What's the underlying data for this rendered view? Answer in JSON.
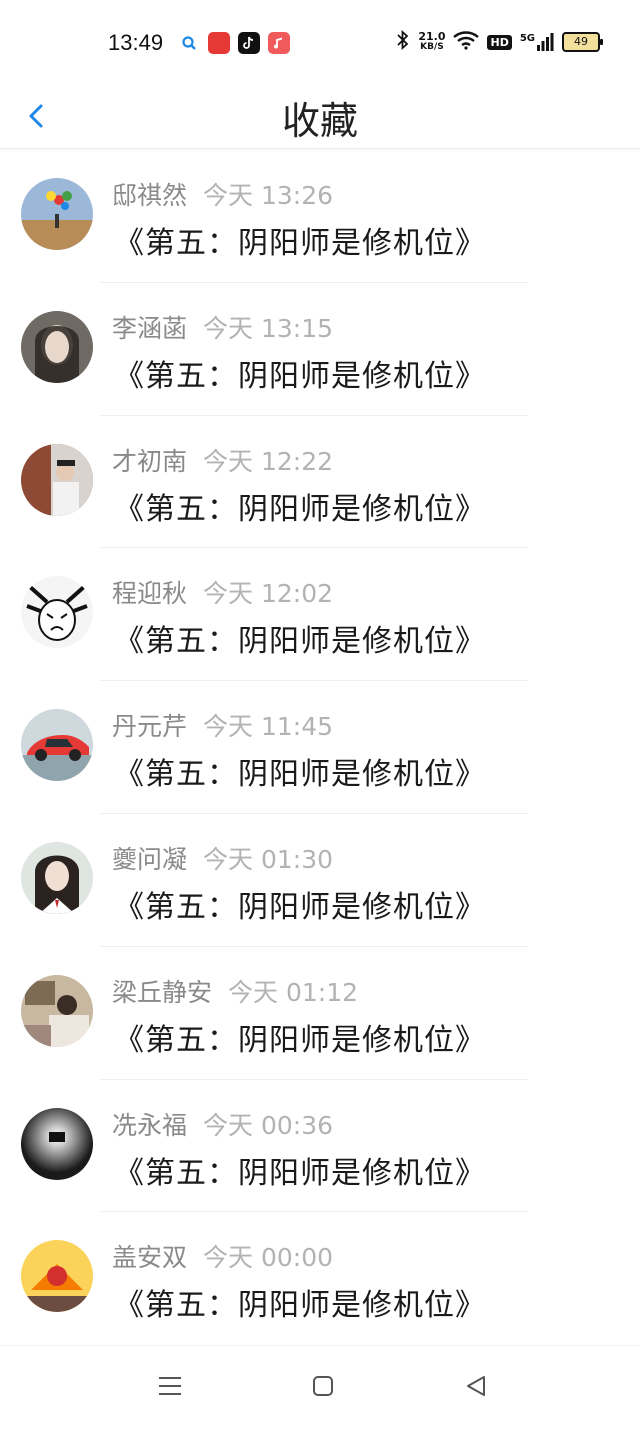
{
  "status_bar": {
    "time": "13:49",
    "network_speed_value": "21.0",
    "network_speed_unit": "KB/S",
    "hd": "HD",
    "signal": "5G",
    "battery": "49",
    "app_icons": [
      "search-icon",
      "news-app-icon",
      "tiktok-icon",
      "music-icon"
    ]
  },
  "header": {
    "title": "收藏",
    "back_icon": "chevron-left-icon"
  },
  "favorites": [
    {
      "name": "邸祺然",
      "time": "今天 13:26",
      "content": "《第五：阴阳师是修机位》"
    },
    {
      "name": "李涵菡",
      "time": "今天 13:15",
      "content": "《第五：阴阳师是修机位》"
    },
    {
      "name": "才初南",
      "time": "今天 12:22",
      "content": "《第五：阴阳师是修机位》"
    },
    {
      "name": "程迎秋",
      "time": "今天 12:02",
      "content": "《第五：阴阳师是修机位》"
    },
    {
      "name": "丹元芹",
      "time": "今天 11:45",
      "content": "《第五：阴阳师是修机位》"
    },
    {
      "name": "夔问凝",
      "time": "今天 01:30",
      "content": "《第五：阴阳师是修机位》"
    },
    {
      "name": "梁丘静安",
      "time": "今天 01:12",
      "content": "《第五：阴阳师是修机位》"
    },
    {
      "name": "冼永福",
      "time": "今天 00:36",
      "content": "《第五：阴阳师是修机位》"
    },
    {
      "name": "盖安双",
      "time": "今天 00:00",
      "content": "《第五：阴阳师是修机位》"
    }
  ],
  "nav_bar": {
    "menu_icon": "menu-icon",
    "home_icon": "home-square-icon",
    "back_icon": "back-triangle-icon"
  },
  "colors": {
    "accent": "#1e88e5",
    "name_gray": "#8a8a8a",
    "time_gray": "#b3b3b3"
  }
}
